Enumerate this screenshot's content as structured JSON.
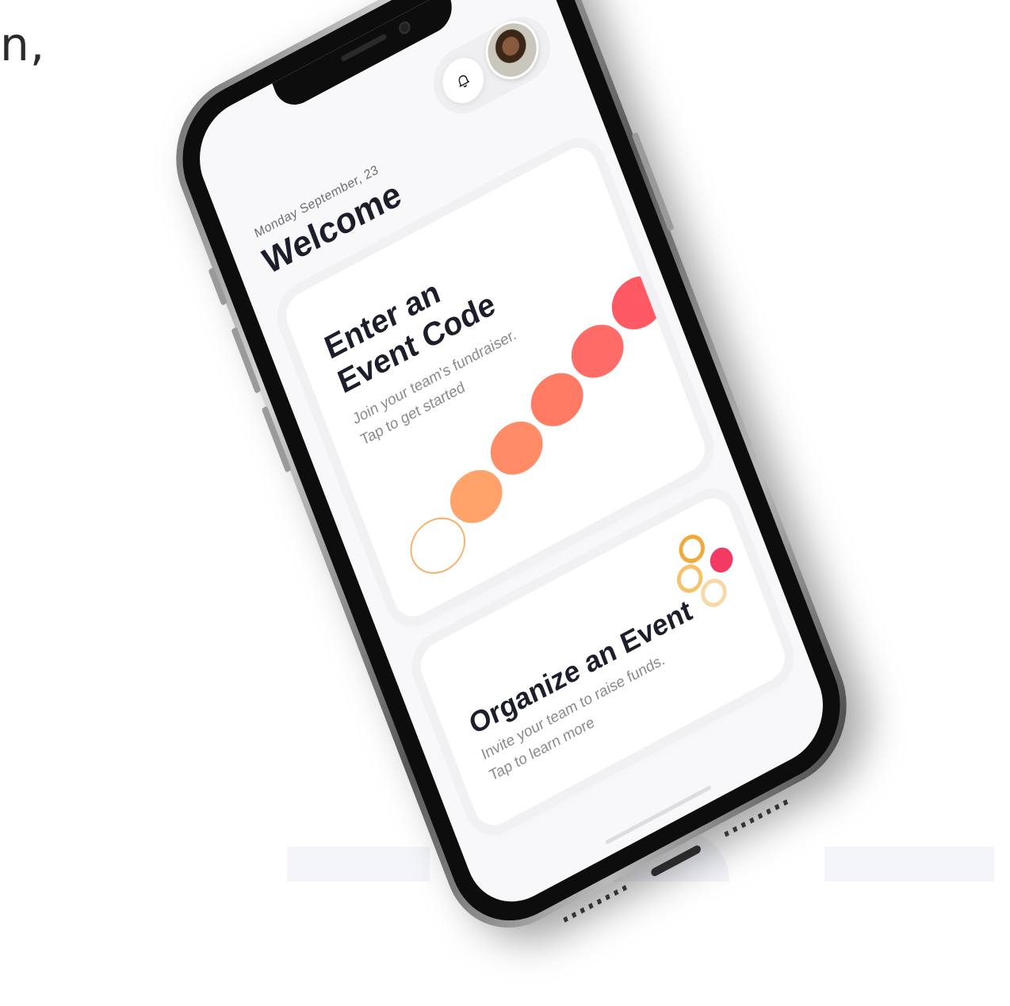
{
  "background": {
    "corner_text": "n,"
  },
  "status": {
    "date": "Monday September, 23"
  },
  "header": {
    "title": "Welcome"
  },
  "icons": {
    "notification": "bell-icon",
    "profile": "avatar"
  },
  "cards": [
    {
      "title_line1": "Enter an",
      "title_line2": "Event Code",
      "subtitle_line1": "Join your team's fundraiser.",
      "subtitle_line2": "Tap to get started"
    },
    {
      "title": "Organize an Event",
      "subtitle_line1": "Invite your team to raise funds.",
      "subtitle_line2": "Tap to learn more"
    }
  ],
  "colors": {
    "text_primary": "#1d1e2c",
    "text_secondary": "#8a8a8f",
    "dot_gradient": [
      "#ffffff",
      "#ffa36b",
      "#ff8c66",
      "#ff7a62",
      "#ff6b66",
      "#ff5a63"
    ],
    "accent_ring": "#f2a93b",
    "accent_pink": "#f23a63"
  }
}
